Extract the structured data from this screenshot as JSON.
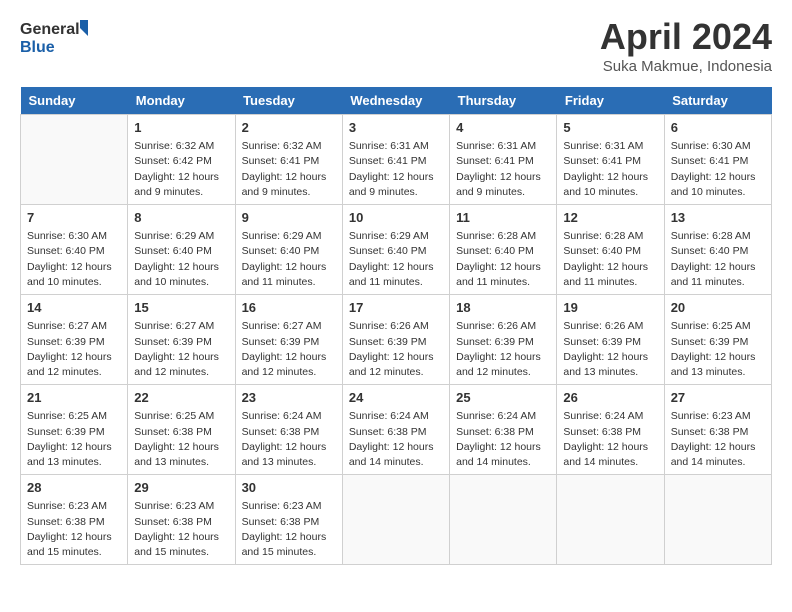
{
  "header": {
    "logo_line1": "General",
    "logo_line2": "Blue",
    "month_title": "April 2024",
    "subtitle": "Suka Makmue, Indonesia"
  },
  "days_of_week": [
    "Sunday",
    "Monday",
    "Tuesday",
    "Wednesday",
    "Thursday",
    "Friday",
    "Saturday"
  ],
  "weeks": [
    [
      {
        "day": "",
        "info": ""
      },
      {
        "day": "1",
        "info": "Sunrise: 6:32 AM\nSunset: 6:42 PM\nDaylight: 12 hours\nand 9 minutes."
      },
      {
        "day": "2",
        "info": "Sunrise: 6:32 AM\nSunset: 6:41 PM\nDaylight: 12 hours\nand 9 minutes."
      },
      {
        "day": "3",
        "info": "Sunrise: 6:31 AM\nSunset: 6:41 PM\nDaylight: 12 hours\nand 9 minutes."
      },
      {
        "day": "4",
        "info": "Sunrise: 6:31 AM\nSunset: 6:41 PM\nDaylight: 12 hours\nand 9 minutes."
      },
      {
        "day": "5",
        "info": "Sunrise: 6:31 AM\nSunset: 6:41 PM\nDaylight: 12 hours\nand 10 minutes."
      },
      {
        "day": "6",
        "info": "Sunrise: 6:30 AM\nSunset: 6:41 PM\nDaylight: 12 hours\nand 10 minutes."
      }
    ],
    [
      {
        "day": "7",
        "info": "Sunrise: 6:30 AM\nSunset: 6:40 PM\nDaylight: 12 hours\nand 10 minutes."
      },
      {
        "day": "8",
        "info": "Sunrise: 6:29 AM\nSunset: 6:40 PM\nDaylight: 12 hours\nand 10 minutes."
      },
      {
        "day": "9",
        "info": "Sunrise: 6:29 AM\nSunset: 6:40 PM\nDaylight: 12 hours\nand 11 minutes."
      },
      {
        "day": "10",
        "info": "Sunrise: 6:29 AM\nSunset: 6:40 PM\nDaylight: 12 hours\nand 11 minutes."
      },
      {
        "day": "11",
        "info": "Sunrise: 6:28 AM\nSunset: 6:40 PM\nDaylight: 12 hours\nand 11 minutes."
      },
      {
        "day": "12",
        "info": "Sunrise: 6:28 AM\nSunset: 6:40 PM\nDaylight: 12 hours\nand 11 minutes."
      },
      {
        "day": "13",
        "info": "Sunrise: 6:28 AM\nSunset: 6:40 PM\nDaylight: 12 hours\nand 11 minutes."
      }
    ],
    [
      {
        "day": "14",
        "info": "Sunrise: 6:27 AM\nSunset: 6:39 PM\nDaylight: 12 hours\nand 12 minutes."
      },
      {
        "day": "15",
        "info": "Sunrise: 6:27 AM\nSunset: 6:39 PM\nDaylight: 12 hours\nand 12 minutes."
      },
      {
        "day": "16",
        "info": "Sunrise: 6:27 AM\nSunset: 6:39 PM\nDaylight: 12 hours\nand 12 minutes."
      },
      {
        "day": "17",
        "info": "Sunrise: 6:26 AM\nSunset: 6:39 PM\nDaylight: 12 hours\nand 12 minutes."
      },
      {
        "day": "18",
        "info": "Sunrise: 6:26 AM\nSunset: 6:39 PM\nDaylight: 12 hours\nand 12 minutes."
      },
      {
        "day": "19",
        "info": "Sunrise: 6:26 AM\nSunset: 6:39 PM\nDaylight: 12 hours\nand 13 minutes."
      },
      {
        "day": "20",
        "info": "Sunrise: 6:25 AM\nSunset: 6:39 PM\nDaylight: 12 hours\nand 13 minutes."
      }
    ],
    [
      {
        "day": "21",
        "info": "Sunrise: 6:25 AM\nSunset: 6:39 PM\nDaylight: 12 hours\nand 13 minutes."
      },
      {
        "day": "22",
        "info": "Sunrise: 6:25 AM\nSunset: 6:38 PM\nDaylight: 12 hours\nand 13 minutes."
      },
      {
        "day": "23",
        "info": "Sunrise: 6:24 AM\nSunset: 6:38 PM\nDaylight: 12 hours\nand 13 minutes."
      },
      {
        "day": "24",
        "info": "Sunrise: 6:24 AM\nSunset: 6:38 PM\nDaylight: 12 hours\nand 14 minutes."
      },
      {
        "day": "25",
        "info": "Sunrise: 6:24 AM\nSunset: 6:38 PM\nDaylight: 12 hours\nand 14 minutes."
      },
      {
        "day": "26",
        "info": "Sunrise: 6:24 AM\nSunset: 6:38 PM\nDaylight: 12 hours\nand 14 minutes."
      },
      {
        "day": "27",
        "info": "Sunrise: 6:23 AM\nSunset: 6:38 PM\nDaylight: 12 hours\nand 14 minutes."
      }
    ],
    [
      {
        "day": "28",
        "info": "Sunrise: 6:23 AM\nSunset: 6:38 PM\nDaylight: 12 hours\nand 15 minutes."
      },
      {
        "day": "29",
        "info": "Sunrise: 6:23 AM\nSunset: 6:38 PM\nDaylight: 12 hours\nand 15 minutes."
      },
      {
        "day": "30",
        "info": "Sunrise: 6:23 AM\nSunset: 6:38 PM\nDaylight: 12 hours\nand 15 minutes."
      },
      {
        "day": "",
        "info": ""
      },
      {
        "day": "",
        "info": ""
      },
      {
        "day": "",
        "info": ""
      },
      {
        "day": "",
        "info": ""
      }
    ]
  ]
}
